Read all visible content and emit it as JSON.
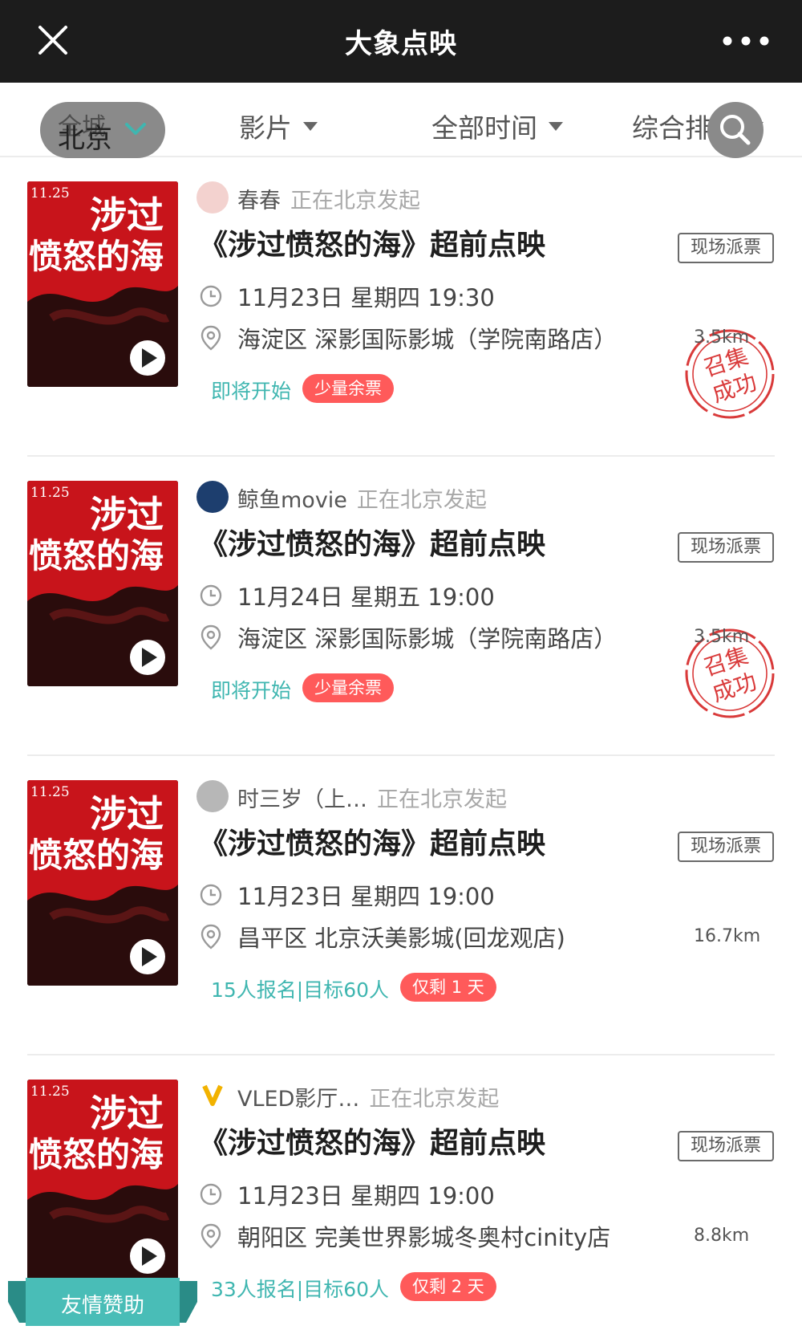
{
  "app": {
    "title": "大象点映",
    "close_icon": "close-icon",
    "more_icon": "more-icon"
  },
  "filters": {
    "city_ghost": "全城",
    "city": "北京",
    "film": "影片",
    "time": "全部时间",
    "sort": "综合排序",
    "search_icon": "search-icon"
  },
  "cards": [
    {
      "host": "春春",
      "host_sub": "正在北京发起",
      "title": "《涉过愤怒的海》超前点映",
      "tag": "现场派票",
      "datetime": "11月23日 星期四 19:30",
      "place": "海淀区 深影国际影城（学院南路店）",
      "distance": "3.5km",
      "status": "即将开始",
      "badge": "少量余票",
      "stamp_line1": "召集",
      "stamp_line2": "成功",
      "avatar_color": "#f3d2cf"
    },
    {
      "host": "鲸鱼movie",
      "host_sub": "正在北京发起",
      "title": "《涉过愤怒的海》超前点映",
      "tag": "现场派票",
      "datetime": "11月24日 星期五 19:00",
      "place": "海淀区 深影国际影城（学院南路店）",
      "distance": "3.5km",
      "status": "即将开始",
      "badge": "少量余票",
      "stamp_line1": "召集",
      "stamp_line2": "成功",
      "avatar_color": "#1d3e6e"
    },
    {
      "host": "时三岁（上…",
      "host_sub": "正在北京发起",
      "title": "《涉过愤怒的海》超前点映",
      "tag": "现场派票",
      "datetime": "11月23日 星期四 19:00",
      "place": "昌平区 北京沃美影城(回龙观店)",
      "distance": "16.7km",
      "status": "15人报名|目标60人",
      "badge": "仅剩 1 天",
      "avatar_color": "#b7b7b7"
    },
    {
      "host": "VLED影厅…",
      "host_sub": "正在北京发起",
      "title": "《涉过愤怒的海》超前点映",
      "tag": "现场派票",
      "datetime": "11月23日 星期四 19:00",
      "place": "朝阳区 完美世界影城冬奥村cinity店",
      "distance": "8.8km",
      "status": "33人报名|目标60人",
      "badge": "仅剩 2 天",
      "avatar_color": "#ffffff"
    }
  ],
  "poster": {
    "date_text": "11.25",
    "title_line1": "涉过",
    "title_line2": "愤怒的海"
  },
  "sponsor_label": "友情赞助",
  "colors": {
    "titlebar": "#1c1c1c",
    "accent_teal": "#3fb6b0",
    "badge_red": "#ff5a5a",
    "stamp_red": "#d93a3a",
    "poster_red": "#c8141b"
  }
}
